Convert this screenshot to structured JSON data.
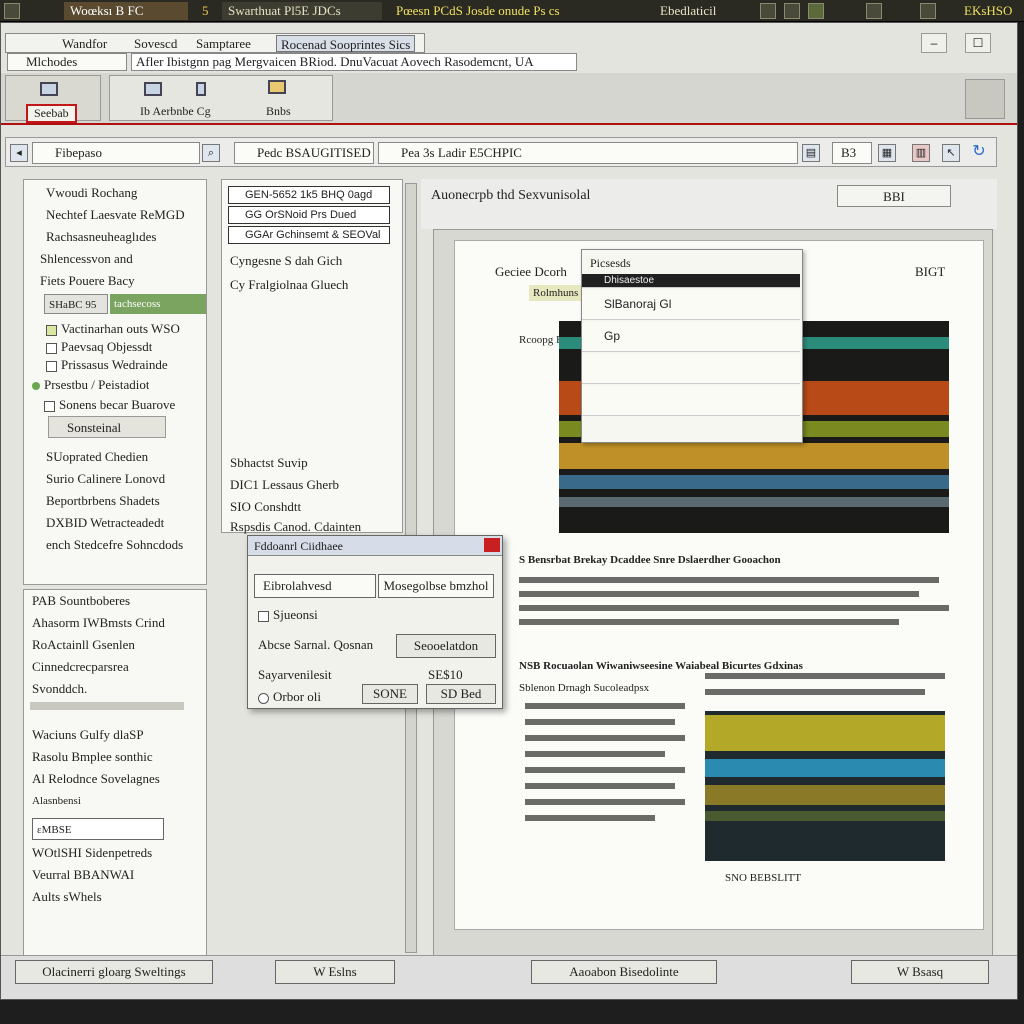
{
  "taskbar": {
    "items": [
      "Woœksı B FC",
      "5",
      "Swarthuat Pl5E JDCs",
      "Pœesn PCdS Josde onude Ps cs",
      "Ebedlaticil",
      "EKsHSO"
    ]
  },
  "window": {
    "menu": [
      "Wandfor",
      "Sovescd",
      "Samptaree",
      "Rocenad Sooprintes Sics"
    ],
    "tab_label": "Mlchodes",
    "address": "Afler Ibistgnn pag Mergvaicen BRiod. DnuVacuat Aovech Rasodemcnt, UA",
    "controls": [
      "–",
      "☐"
    ]
  },
  "ribbon": {
    "selected_label": "Seebab",
    "group_label": "Ib Aerbnbe Cg",
    "tool_label": "Bnbs"
  },
  "toolbar": {
    "search": "Fibepaso",
    "breadcrumb": "Pedc BSAUGITISED",
    "path": "Pea 3s Ladir E5CHPIC",
    "zoom": "B3"
  },
  "left_panel": {
    "items": [
      "Vwoudi Rochang",
      "Nechtef Laesvate ReMGD",
      "Rachsasneuheaglıdes",
      "Shlencessvon and",
      "Fiets Pouere Bacy"
    ],
    "tab_a": "SHaBC 95",
    "tab_b": "tachsecoss",
    "checked": [
      "Vactinarhan outs WSO",
      "Paevsaq Objessdt",
      "Prissasus Wedrainde",
      "Prsestbu / Peistadiot",
      "Sonens becar Buarove"
    ],
    "selected": "Sonsteinal",
    "tree": [
      "SUoprated Chedien",
      "Surio Calinere Lonovd",
      "Beportbrbens Shadets",
      "DXBID Wetracteadedt",
      "ench Stedcefre Sohncdods"
    ],
    "section2": [
      "PAB Sountboberes",
      "Ahasorm IWBmsts Crind",
      "RoActainll Gsenlen",
      "Cinnedcrecparsrea",
      "Svonddch."
    ],
    "section3": [
      "Waciuns Gulfy dlaSP",
      "Rasolu Bmplee sonthic",
      "Al Relodnce Sovelagnes",
      "Alasnbensi"
    ],
    "section4": [
      "ɛMBSE",
      "WOtlSHI Sidenpetreds",
      "Veurral BBANWAI",
      "Aults sWhels"
    ]
  },
  "mid_panel": {
    "fields": [
      "GEN-5652 1k5 BHQ 0agd",
      "GG OrSNoid Prs Dued",
      "GGAr Gchinsemt & SEOVal"
    ],
    "labels": [
      "Cyngesne S dah Gich",
      "Cy Fralgiolnaa Gluech"
    ],
    "list": [
      "Sbhactst Suvip",
      "DIC1 Lessaus Gherb",
      "SIO Conshdtt",
      "Rspsdis Canod. Cdainten"
    ]
  },
  "dialog": {
    "title": "Fddoanrl Ciidhaee",
    "field_left": "Eibrolahvesd",
    "field_right": "Mosegolbse bmzhol",
    "option": "Sjueonsi",
    "search_label": "Abcse Sarnal. Qosnan",
    "search_btn": "Seooelatdon",
    "status": "Sayarvenilesit",
    "count": "SE$10",
    "radio": "Orbor oli",
    "ok": "SONE",
    "cancel": "SD Bed"
  },
  "content": {
    "title": "Auonecrpb thd Sexvunisolal",
    "side_value": "BBI",
    "page_header": "Geciee Dcorh",
    "page_badge": "BIGT",
    "tab": "Rolmhuns",
    "heading": "Rcoopg Bor",
    "body_title": "S Bensrbat Brekay Dcaddee Snre Dslaerdher Gooachon",
    "section": "NSB Rocuaolan Wiwaniwseesine Waiabeal Bicurtes Gdxinas",
    "col_title": "Sblenon Drnagh Sucoleadpsx",
    "footer": "SNO BEBSLITT"
  },
  "popup": {
    "title": "Picsesds",
    "item1": "Dhisaestoe",
    "item2": "SlBanoraj Gl",
    "item3": "Gp"
  },
  "statusbar": {
    "left": "Olacinerri gloarg Sweltings",
    "btn1": "W Eslns",
    "mid": "Aaoabon Bisedolinte",
    "btn2": "W Bsasq"
  }
}
